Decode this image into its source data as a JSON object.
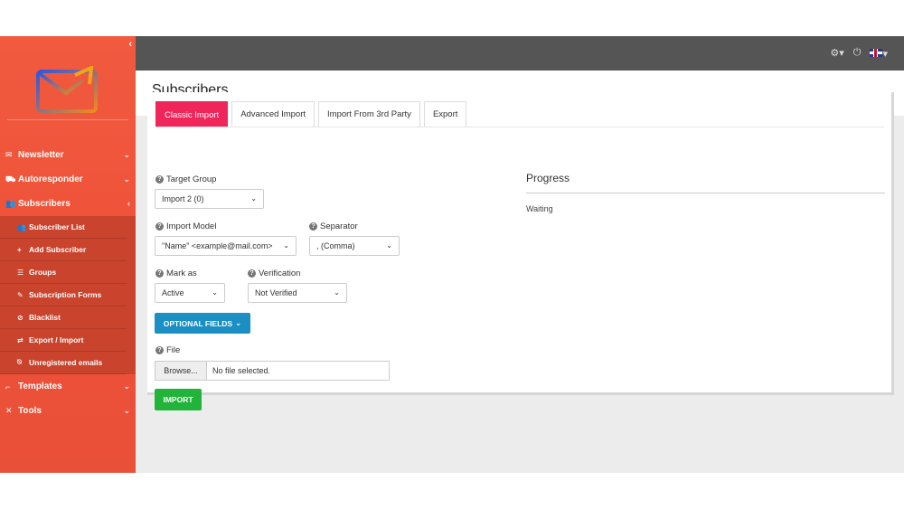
{
  "sidebar": {
    "collapse_icon": "chevron-left-icon",
    "logo_icon": "envelope-logo-icon",
    "items": [
      {
        "label": "Newsletter",
        "icon": "envelope-icon"
      },
      {
        "label": "Autoresponder",
        "icon": "car-icon"
      },
      {
        "label": "Subscribers",
        "icon": "users-icon"
      }
    ],
    "subscribers_sub": [
      {
        "label": "Subscriber List",
        "icon": "users-icon"
      },
      {
        "label": "Add Subscriber",
        "icon": "plus-icon"
      },
      {
        "label": "Groups",
        "icon": "list-icon"
      },
      {
        "label": "Subscription Forms",
        "icon": "edit-icon"
      },
      {
        "label": "Blacklist",
        "icon": "ban-icon"
      },
      {
        "label": "Export / Import",
        "icon": "exchange-icon"
      },
      {
        "label": "Unregistered emails",
        "icon": "user-slash-icon"
      }
    ],
    "bottom_items": [
      {
        "label": "Templates",
        "icon": "paint-roller-icon"
      },
      {
        "label": "Tools",
        "icon": "tools-icon"
      }
    ]
  },
  "topbar": {
    "settings_icon": "gear-icon",
    "power_icon": "power-icon",
    "language_icon": "uk-flag-icon"
  },
  "page": {
    "title": "Subscribers"
  },
  "tabs": [
    {
      "label": "Classic Import",
      "active": true
    },
    {
      "label": "Advanced Import",
      "active": false
    },
    {
      "label": "Import From 3rd Party",
      "active": false
    },
    {
      "label": "Export",
      "active": false
    }
  ],
  "form": {
    "target_group_label": "Target Group",
    "target_group_value": "Import 2 (0)",
    "import_model_label": "Import Model",
    "import_model_value": "\"Name\" <example@mail.com>",
    "separator_label": "Separator",
    "separator_value": ", (Comma)",
    "mark_as_label": "Mark as",
    "mark_as_value": "Active",
    "verification_label": "Verification",
    "verification_value": "Not Verified",
    "optional_fields_label": "OPTIONAL FIELDS",
    "file_label": "File",
    "browse_label": "Browse...",
    "file_name": "No file selected.",
    "import_label": "IMPORT"
  },
  "progress": {
    "title": "Progress",
    "status": "Waiting"
  },
  "colors": {
    "sidebar": "#f15a3f",
    "active_tab": "#f0265b",
    "optional_button": "#1b8fc4",
    "import_button": "#22b43a",
    "topbar": "#555555"
  }
}
